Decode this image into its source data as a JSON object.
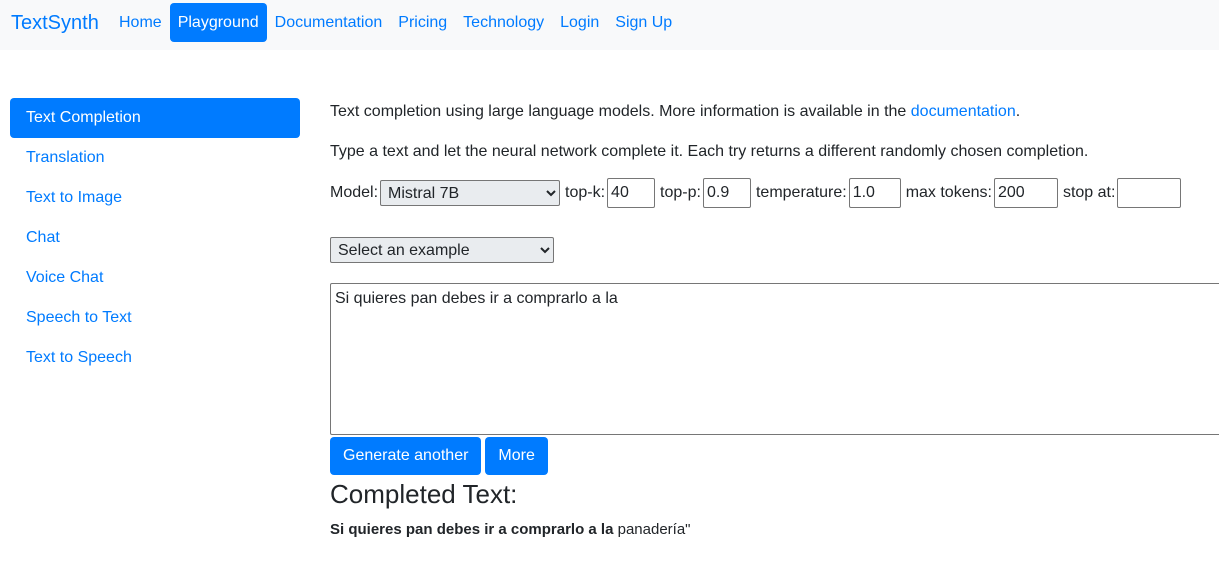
{
  "brand": "TextSynth",
  "nav": [
    {
      "label": "Home",
      "active": false
    },
    {
      "label": "Playground",
      "active": true
    },
    {
      "label": "Documentation",
      "active": false
    },
    {
      "label": "Pricing",
      "active": false
    },
    {
      "label": "Technology",
      "active": false
    },
    {
      "label": "Login",
      "active": false
    },
    {
      "label": "Sign Up",
      "active": false
    }
  ],
  "sidebar": [
    {
      "label": "Text Completion",
      "active": true
    },
    {
      "label": "Translation",
      "active": false
    },
    {
      "label": "Text to Image",
      "active": false
    },
    {
      "label": "Chat",
      "active": false
    },
    {
      "label": "Voice Chat",
      "active": false
    },
    {
      "label": "Speech to Text",
      "active": false
    },
    {
      "label": "Text to Speech",
      "active": false
    }
  ],
  "intro": {
    "text": "Text completion using large language models. More information is available in the ",
    "link": "documentation",
    "end": "."
  },
  "instruction": "Type a text and let the neural network complete it. Each try returns a different randomly chosen completion.",
  "params": {
    "model_label": "Model:",
    "model_value": "Mistral 7B",
    "topk_label": "top-k:",
    "topk_value": "40",
    "topp_label": "top-p:",
    "topp_value": "0.9",
    "temperature_label": "temperature:",
    "temperature_value": "1.0",
    "max_tokens_label": "max tokens:",
    "max_tokens_value": "200",
    "stop_label": "stop at:",
    "stop_value": ""
  },
  "example_select": "Select an example",
  "prompt_text": "Si quieres pan debes ir a comprarlo a la",
  "buttons": {
    "generate": "Generate another",
    "more": "More"
  },
  "result": {
    "title": "Completed Text:",
    "prompt": "Si quieres pan debes ir a comprarlo a la",
    "completion": " panadería\""
  },
  "colors": {
    "accent": "#007bff",
    "navbar_bg": "#f8f9fa",
    "text": "#212529"
  }
}
